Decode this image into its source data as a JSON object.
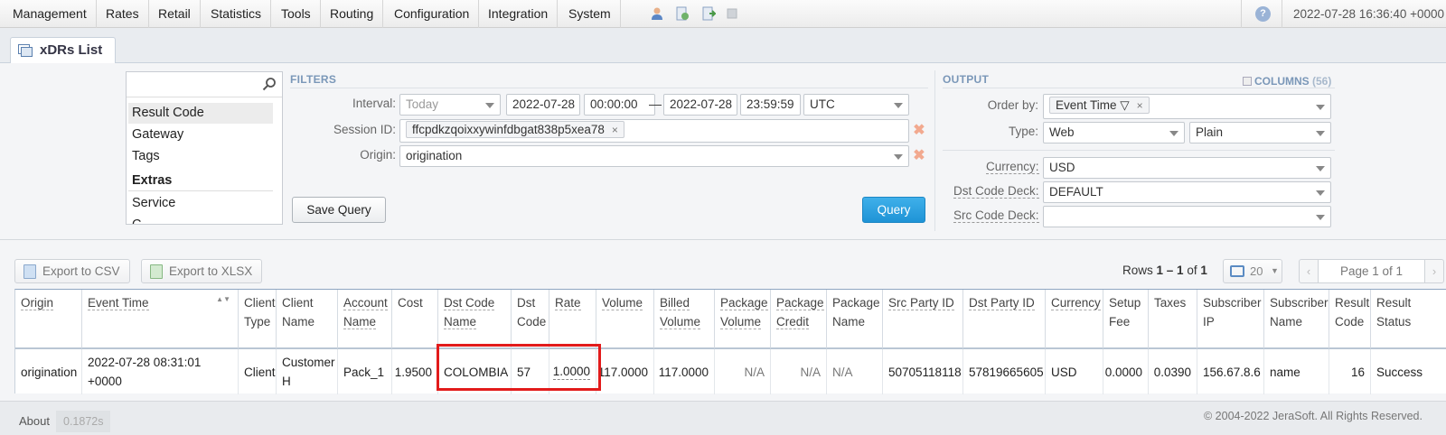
{
  "nav": {
    "menu": [
      "Management",
      "Rates",
      "Retail",
      "Statistics",
      "Tools",
      "Routing",
      "Configuration",
      "Integration",
      "System"
    ],
    "icons": [
      "user-icon",
      "document-refresh-icon",
      "document-export-icon",
      "square-icon"
    ],
    "help_glyph": "?",
    "datetime": "2022-07-28 16:36:40 +0000"
  },
  "tab": {
    "title": "xDRs List"
  },
  "picker": {
    "search_value": "",
    "items": [
      "Result Code",
      "Gateway",
      "Tags"
    ],
    "section": "Extras",
    "section_items": [
      "Service",
      "C"
    ]
  },
  "filters": {
    "title": "FILTERS",
    "interval_label": "Interval:",
    "interval_value": "Today",
    "date_from": "2022-07-28",
    "time_from": "00:00:00",
    "range_dash": "—",
    "date_to": "2022-07-28",
    "time_to": "23:59:59",
    "timezone": "UTC",
    "session_label": "Session ID:",
    "session_value": "ffcpdkzqoixxywinfdbgat838p5xea78",
    "origin_label": "Origin:",
    "origin_value": "origination",
    "chip_remove": "×",
    "clear_glyph": "✖",
    "save_query": "Save Query",
    "query": "Query"
  },
  "output": {
    "title": "OUTPUT",
    "columns_label": "COLUMNS",
    "columns_count": "(56)",
    "order_label": "Order by:",
    "order_value": "Event Time ▽",
    "type_label": "Type:",
    "type_value": "Web",
    "format_value": "Plain",
    "currency_label": "Currency:",
    "currency_value": "USD",
    "dst_deck_label": "Dst Code Deck:",
    "dst_deck_value": "DEFAULT",
    "src_deck_label": "Src Code Deck:",
    "src_deck_value": ""
  },
  "toolbar": {
    "export_csv": "Export to CSV",
    "export_xlsx": "Export to XLSX",
    "rows_prefix": "Rows",
    "rows_range": "1 – 1",
    "rows_of": "of",
    "rows_total": "1",
    "per_page": "20",
    "per_page_caret": "▼",
    "page_label": "Page 1 of 1",
    "prev": "‹",
    "next": "›"
  },
  "table": {
    "sort_glyph": "▲▼",
    "columns": [
      {
        "l1": "Origin",
        "l2": ""
      },
      {
        "l1": "Event Time",
        "l2": ""
      },
      {
        "l1": "Client",
        "l2": "Type"
      },
      {
        "l1": "Client",
        "l2": "Name"
      },
      {
        "l1": "Account",
        "l2": "Name"
      },
      {
        "l1": "Cost",
        "l2": ""
      },
      {
        "l1": "Dst Code",
        "l2": "Name"
      },
      {
        "l1": "Dst",
        "l2": "Code"
      },
      {
        "l1": "Rate",
        "l2": ""
      },
      {
        "l1": "Volume",
        "l2": ""
      },
      {
        "l1": "Billed",
        "l2": "Volume"
      },
      {
        "l1": "Package",
        "l2": "Volume"
      },
      {
        "l1": "Package",
        "l2": "Credit"
      },
      {
        "l1": "Package",
        "l2": "Name"
      },
      {
        "l1": "Src Party ID",
        "l2": ""
      },
      {
        "l1": "Dst Party ID",
        "l2": ""
      },
      {
        "l1": "Currency",
        "l2": ""
      },
      {
        "l1": "Setup",
        "l2": "Fee"
      },
      {
        "l1": "Taxes",
        "l2": ""
      },
      {
        "l1": "Subscriber",
        "l2": "IP"
      },
      {
        "l1": "Subscriber",
        "l2": "Name"
      },
      {
        "l1": "Result",
        "l2": "Code"
      },
      {
        "l1": "Result",
        "l2": "Status"
      }
    ],
    "row": [
      "origination",
      "2022-07-28 08:31:01 +0000",
      "Client",
      "Customer H",
      "Pack_1",
      "1.9500",
      "COLOMBIA",
      "57",
      "1.0000",
      "117.0000",
      "117.0000",
      "N/A",
      "N/A",
      "N/A",
      "50705118118",
      "57819665605",
      "USD",
      "0.0000",
      "0.0390",
      "156.67.8.6",
      "name",
      "16",
      "Success"
    ]
  },
  "footer": {
    "about": "About",
    "timing": "0.1872s",
    "copyright": "© 2004-2022 JeraSoft. All Rights Reserved."
  },
  "colors": {
    "accent": "#2a9de0",
    "highlight": "#e21b1b",
    "section_title": "#7a97b8"
  }
}
